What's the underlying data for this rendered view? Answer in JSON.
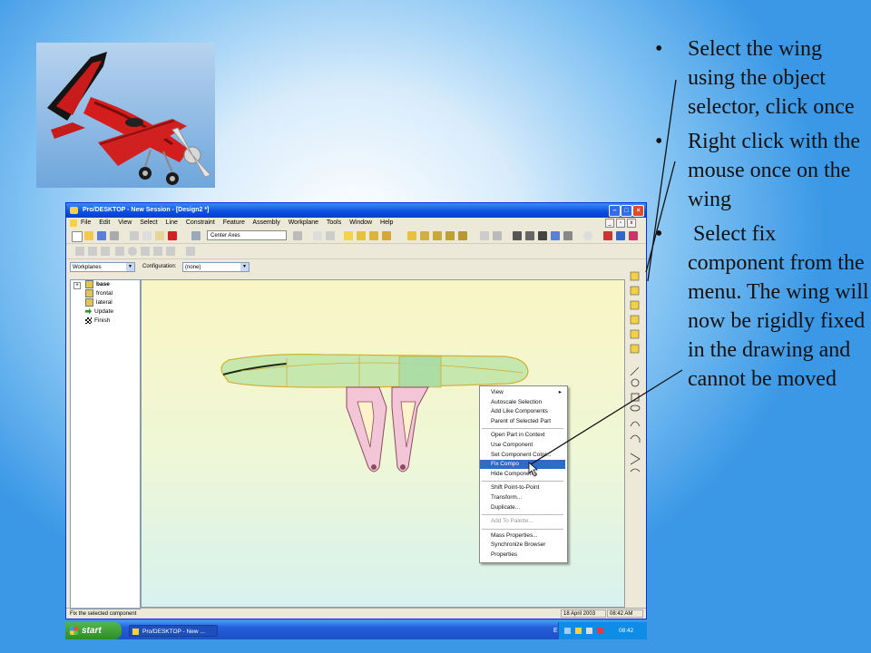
{
  "bullets": [
    "Select the wing using the object selector, click once",
    "Right click with the mouse once on the wing",
    " Select fix component from the menu. The wing will now be rigidly fixed in the drawing and cannot be moved"
  ],
  "bullet_char": "•",
  "window": {
    "title": "Pro/DESKTOP - New Session - [Design2 *]",
    "menu": [
      "File",
      "Edit",
      "View",
      "Select",
      "Line",
      "Constraint",
      "Feature",
      "Assembly",
      "Workplane",
      "Tools",
      "Window",
      "Help"
    ],
    "center_axes": "Center Axes",
    "workplanes_combo": "Workplanes",
    "configuration_label": "Configuration:",
    "configuration_value": "(none)"
  },
  "tree": {
    "expander": "+",
    "items": [
      {
        "label": "base",
        "bold": true,
        "icon": "sketch-icon"
      },
      {
        "label": "frontal",
        "icon": "sketch-icon"
      },
      {
        "label": "lateral",
        "icon": "sketch-icon"
      },
      {
        "label": "Update",
        "icon": "green-arrow-icon"
      },
      {
        "label": "Finish",
        "icon": "checkered-flag-icon"
      }
    ]
  },
  "context_menu": [
    {
      "label": "View",
      "submenu": true
    },
    {
      "label": "Autoscale Selection"
    },
    {
      "label": "Add Like Components"
    },
    {
      "label": "Parent of Selected Part"
    },
    {
      "separator": true
    },
    {
      "label": "Open Part in Context"
    },
    {
      "label": "Use Component"
    },
    {
      "label": "Set Component Color..."
    },
    {
      "label": "Fix Component",
      "highlighted": true
    },
    {
      "label": "Hide Components"
    },
    {
      "separator": true
    },
    {
      "label": "Shift Point-to-Point"
    },
    {
      "label": "Transform..."
    },
    {
      "label": "Duplicate..."
    },
    {
      "separator": true
    },
    {
      "label": "Add To Palette...",
      "disabled": true
    },
    {
      "separator": true
    },
    {
      "label": "Mass Properties..."
    },
    {
      "label": "Synchronize Browser"
    },
    {
      "label": "Properties"
    }
  ],
  "fix_component_visible": "Fix Compo",
  "status": {
    "message": "Fix the selected component",
    "date": "18 April 2003",
    "time": "08:42 AM"
  },
  "taskbar": {
    "start": "start",
    "task_item": "Pro/DESKTOP - New ...",
    "language": "EN",
    "clock": "08:42"
  },
  "colors": {
    "titlebar": "#0a4ee0",
    "highlight": "#316ac5",
    "plane_red": "#d41e1e",
    "model_green": "#bfe3a0",
    "bracket_pink": "#f2c6d6"
  }
}
